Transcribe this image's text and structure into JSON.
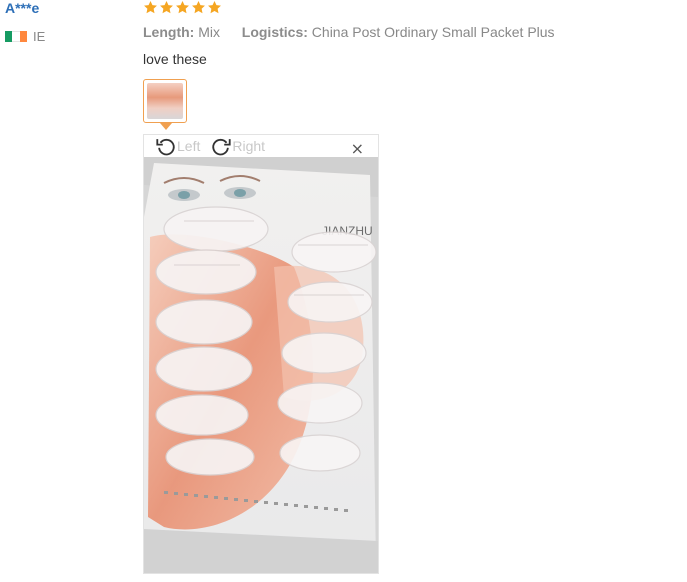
{
  "review": {
    "user": "A***e",
    "country_code": "IE",
    "rating": 5,
    "length_key": "Length:",
    "length_value": "Mix",
    "logistics_key": "Logistics:",
    "logistics_value": "China Post Ordinary Small Packet Plus",
    "comment": "love these"
  },
  "viewer": {
    "rotate_left_label": "Left",
    "rotate_right_label": "Right",
    "close_label": "×",
    "package_text": "JIANZHU"
  },
  "colors": {
    "username": "#2d6fb7",
    "star": "#f5a623",
    "thumb_border": "#f0a050"
  },
  "icons": [
    "star-icon",
    "rotate-left-icon",
    "rotate-right-icon",
    "close-icon",
    "flag-ie-icon"
  ]
}
